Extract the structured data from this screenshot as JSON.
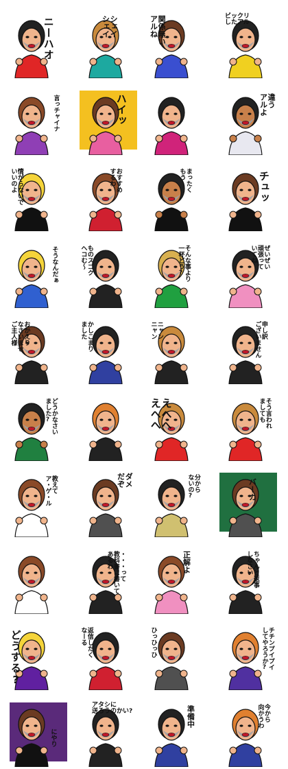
{
  "stickers": [
    {
      "caption": "ニーハオ",
      "bg": "",
      "outfit": "#e02626",
      "hair": "#222222",
      "skin": "#f0b48c"
    },
    {
      "caption": "シェイ\nシェイ",
      "bg": "",
      "outfit": "#1da9a0",
      "hair": "#c98a3c",
      "skin": "#f0b48c"
    },
    {
      "caption": "関係無い\nアルね",
      "bg": "",
      "outfit": "#3a4fd0",
      "hair": "#6b3b22",
      "skin": "#f0b48c"
    },
    {
      "caption": "ビックリ\nしたアル",
      "bg": "",
      "outfit": "#f0d020",
      "hair": "#222222",
      "skin": "#f0b48c"
    },
    {
      "caption": "言っチャイナ",
      "bg": "",
      "outfit": "#8f3fb5",
      "hair": "#8a4a28",
      "skin": "#f0b48c"
    },
    {
      "caption": "ハイッ",
      "bg": "#f4c020",
      "outfit": "#e85fa0",
      "hair": "#6b3b22",
      "skin": "#f0b48c"
    },
    {
      "caption": "",
      "bg": "",
      "outfit": "#d0237a",
      "hair": "#222222",
      "skin": "#f0b48c"
    },
    {
      "caption": "違う\nアルよ",
      "bg": "",
      "outfit": "#e8e8f0",
      "hair": "#222222",
      "skin": "#c8804a"
    },
    {
      "caption": "情がらないで\nいいのよ",
      "bg": "",
      "outfit": "#111111",
      "hair": "#f5d43a",
      "skin": "#f0b48c"
    },
    {
      "caption": "おすすめ\nするわ",
      "bg": "",
      "outfit": "#d02030",
      "hair": "#8a4a28",
      "skin": "#f0b48c"
    },
    {
      "caption": "まったく\nもう",
      "bg": "",
      "outfit": "#111111",
      "hair": "#222222",
      "skin": "#c8804a"
    },
    {
      "caption": "チュッ",
      "bg": "",
      "outfit": "#111111",
      "hair": "#6b3b22",
      "skin": "#f0b48c"
    },
    {
      "caption": "そうなんだぁ",
      "bg": "",
      "outfit": "#3060d0",
      "hair": "#f5d43a",
      "skin": "#f0b48c"
    },
    {
      "caption": "ものスゴク\nへコむ〜",
      "bg": "",
      "outfit": "#222222",
      "hair": "#222222",
      "skin": "#f0b48c"
    },
    {
      "caption": "そんな事より\n一杯どう?",
      "bg": "",
      "outfit": "#20a040",
      "hair": "#d8b050",
      "skin": "#f0b48c"
    },
    {
      "caption": "ぜいぜい\n頑張って\nいてね",
      "bg": "",
      "outfit": "#f090c0",
      "hair": "#222222",
      "skin": "#f0b48c"
    },
    {
      "caption": "おかえり\nなさいませ\nご主人様",
      "bg": "",
      "outfit": "#222222",
      "hair": "#6b3b22",
      "skin": "#f0b48c"
    },
    {
      "caption": "かしこまり\nました",
      "bg": "",
      "outfit": "#3040a0",
      "hair": "#222222",
      "skin": "#f0b48c"
    },
    {
      "caption": "ニャン\nニャン",
      "bg": "",
      "outfit": "#222222",
      "hair": "#c98a3c",
      "skin": "#f0b48c"
    },
    {
      "caption": "申し訳\nございません",
      "bg": "",
      "outfit": "#222222",
      "hair": "#222222",
      "skin": "#f0b48c"
    },
    {
      "caption": "どうかなさい\nました?",
      "bg": "",
      "outfit": "#208040",
      "hair": "#222222",
      "skin": "#c8804a"
    },
    {
      "caption": "",
      "bg": "",
      "outfit": "#222222",
      "hair": "#e08030",
      "skin": "#f0b48c"
    },
    {
      "caption": "えへへ\nえへへ",
      "bg": "",
      "outfit": "#e02626",
      "hair": "#c98a3c",
      "skin": "#f0b48c"
    },
    {
      "caption": "そう言われ\nましても",
      "bg": "",
      "outfit": "#e02626",
      "hair": "#c98a3c",
      "skin": "#f0b48c"
    },
    {
      "caption": "教えて\nア・ゲ・ル",
      "bg": "",
      "outfit": "#ffffff",
      "hair": "#8a4a28",
      "skin": "#f0b48c"
    },
    {
      "caption": "ダメ\nだぞ",
      "bg": "",
      "outfit": "#505050",
      "hair": "#6b3b22",
      "skin": "#f0b48c"
    },
    {
      "caption": "分から\nないの?",
      "bg": "",
      "outfit": "#d0c070",
      "hair": "#222222",
      "skin": "#f0b48c"
    },
    {
      "caption": "バーカ",
      "bg": "#207040",
      "outfit": "#505050",
      "hair": "#6b3b22",
      "skin": "#f0b48c"
    },
    {
      "caption": "",
      "bg": "",
      "outfit": "#ffffff",
      "hair": "#8a4a28",
      "skin": "#f0b48c"
    },
    {
      "caption": "・・・って\n教科書に書いて\nあるわ",
      "bg": "",
      "outfit": "#222222",
      "hair": "#222222",
      "skin": "#f0b48c"
    },
    {
      "caption": "正解よ",
      "bg": "",
      "outfit": "#f090c0",
      "hair": "#8a4a28",
      "skin": "#f0b48c"
    },
    {
      "caption": "ちゃんと返事\nしなさい",
      "bg": "",
      "outfit": "#222222",
      "hair": "#222222",
      "skin": "#f0b48c"
    },
    {
      "caption": "どうする?",
      "bg": "",
      "outfit": "#6020a0",
      "hair": "#f5d43a",
      "skin": "#f0b48c"
    },
    {
      "caption": "返信したく\nなーる",
      "bg": "",
      "outfit": "#d02030",
      "hair": "#222222",
      "skin": "#f0b48c"
    },
    {
      "caption": "ひっひっひ",
      "bg": "",
      "outfit": "#505050",
      "hair": "#6b3b22",
      "skin": "#f0b48c"
    },
    {
      "caption": "チチンプイプイ\nしてやろうか?",
      "bg": "",
      "outfit": "#5030a0",
      "hair": "#e08030",
      "skin": "#f0b48c"
    },
    {
      "caption": "にやり",
      "bg": "#5a2a7a",
      "outfit": "#111111",
      "hair": "#6b3b22",
      "skin": "#f0b48c"
    },
    {
      "caption": "アタシに\n送ろうのかい?",
      "bg": "",
      "outfit": "#222222",
      "hair": "#222222",
      "skin": "#f0b48c"
    },
    {
      "caption": "準備中",
      "bg": "",
      "outfit": "#3040a0",
      "hair": "#222222",
      "skin": "#f0b48c"
    },
    {
      "caption": "今から\n向かうわ",
      "bg": "",
      "outfit": "#3040a0",
      "hair": "#e08030",
      "skin": "#f0b48c"
    }
  ]
}
